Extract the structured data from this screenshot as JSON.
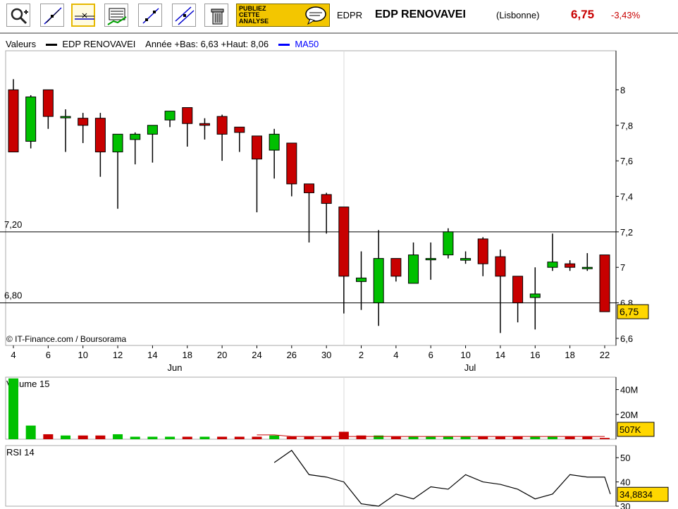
{
  "header": {
    "ticker": "EDPR",
    "name": "EDP RENOVAVEI",
    "market": "(Lisbonne)",
    "price": "6,75",
    "change": "-3,43%"
  },
  "toolbar": {
    "publish_line1": "PUBLIEZ",
    "publish_line2": "CETTE",
    "publish_line3": "ANALYSE",
    "icons": [
      "zoom-icon",
      "trendline-icon",
      "horizontal-line-icon",
      "indicator-icon",
      "fibonacci-icon",
      "parallel-lines-icon",
      "trash-icon",
      "speech-bubble-icon"
    ]
  },
  "legend": {
    "label": "Valeurs",
    "series": "EDP RENOVAVEI",
    "range": "Année +Bas: 6,63 +Haut: 8,06",
    "ma": "MA50"
  },
  "colors": {
    "up": "#00c000",
    "down": "#c80000",
    "ma": "#0000ff",
    "grid": "#d9d9d9",
    "highlight": "#ffd700"
  },
  "chart_data": [
    {
      "type": "candlestick",
      "ylim": [
        6.56,
        8.22
      ],
      "y_ticks": [
        "6,6",
        "6,8",
        "7",
        "7,2",
        "7,4",
        "7,6",
        "7,8",
        "8"
      ],
      "x_tick_labels": [
        "4",
        "6",
        "10",
        "12",
        "14",
        "18",
        "20",
        "24",
        "26",
        "30",
        "2",
        "4",
        "6",
        "10",
        "14",
        "16",
        "18",
        "22"
      ],
      "month_labels": [
        "Jun",
        "Jul"
      ],
      "reference_lines": [
        {
          "value": 7.2,
          "label": "7,20"
        },
        {
          "value": 6.8,
          "label": "6,80"
        }
      ],
      "last_value_label": "6,75",
      "copyright": "© IT-Finance.com / Boursorama",
      "candles": [
        {
          "o": 8.0,
          "h": 8.06,
          "l": 7.65,
          "c": 7.65
        },
        {
          "o": 7.71,
          "h": 7.97,
          "l": 7.67,
          "c": 7.96
        },
        {
          "o": 8.0,
          "h": 8.0,
          "l": 7.78,
          "c": 7.85
        },
        {
          "o": 7.85,
          "h": 7.89,
          "l": 7.65,
          "c": 7.85
        },
        {
          "o": 7.84,
          "h": 7.87,
          "l": 7.7,
          "c": 7.8
        },
        {
          "o": 7.84,
          "h": 7.87,
          "l": 7.51,
          "c": 7.65
        },
        {
          "o": 7.65,
          "h": 7.75,
          "l": 7.33,
          "c": 7.75
        },
        {
          "o": 7.72,
          "h": 7.76,
          "l": 7.58,
          "c": 7.75
        },
        {
          "o": 7.75,
          "h": 7.8,
          "l": 7.59,
          "c": 7.8
        },
        {
          "o": 7.83,
          "h": 7.88,
          "l": 7.79,
          "c": 7.88
        },
        {
          "o": 7.9,
          "h": 7.9,
          "l": 7.68,
          "c": 7.81
        },
        {
          "o": 7.81,
          "h": 7.84,
          "l": 7.72,
          "c": 7.8
        },
        {
          "o": 7.85,
          "h": 7.86,
          "l": 7.6,
          "c": 7.75
        },
        {
          "o": 7.79,
          "h": 7.79,
          "l": 7.65,
          "c": 7.76
        },
        {
          "o": 7.74,
          "h": 7.74,
          "l": 7.31,
          "c": 7.61
        },
        {
          "o": 7.66,
          "h": 7.78,
          "l": 7.5,
          "c": 7.75
        },
        {
          "o": 7.7,
          "h": 7.7,
          "l": 7.4,
          "c": 7.47
        },
        {
          "o": 7.47,
          "h": 7.47,
          "l": 7.14,
          "c": 7.42
        },
        {
          "o": 7.41,
          "h": 7.42,
          "l": 7.19,
          "c": 7.36
        },
        {
          "o": 7.34,
          "h": 7.34,
          "l": 6.74,
          "c": 6.95
        },
        {
          "o": 6.92,
          "h": 7.09,
          "l": 6.76,
          "c": 6.94
        },
        {
          "o": 6.8,
          "h": 7.21,
          "l": 6.67,
          "c": 7.05
        },
        {
          "o": 7.05,
          "h": 7.05,
          "l": 6.92,
          "c": 6.95
        },
        {
          "o": 6.91,
          "h": 7.14,
          "l": 6.91,
          "c": 7.07
        },
        {
          "o": 7.05,
          "h": 7.14,
          "l": 6.93,
          "c": 7.05
        },
        {
          "o": 7.07,
          "h": 7.22,
          "l": 7.05,
          "c": 7.2
        },
        {
          "o": 7.04,
          "h": 7.09,
          "l": 7.02,
          "c": 7.05
        },
        {
          "o": 7.16,
          "h": 7.17,
          "l": 6.95,
          "c": 7.02
        },
        {
          "o": 7.06,
          "h": 7.1,
          "l": 6.63,
          "c": 6.95
        },
        {
          "o": 6.95,
          "h": 6.95,
          "l": 6.69,
          "c": 6.8
        },
        {
          "o": 6.83,
          "h": 7.0,
          "l": 6.65,
          "c": 6.85
        },
        {
          "o": 7.0,
          "h": 7.19,
          "l": 6.98,
          "c": 7.03
        },
        {
          "o": 7.02,
          "h": 7.04,
          "l": 6.98,
          "c": 7.0
        },
        {
          "o": 7.0,
          "h": 7.08,
          "l": 6.98,
          "c": 7.0
        },
        {
          "o": 7.07,
          "h": 7.07,
          "l": 6.75,
          "c": 6.75
        }
      ]
    },
    {
      "type": "bar",
      "title": "Volume 15",
      "ylim": [
        0,
        50
      ],
      "y_ticks": [
        "20M",
        "40M"
      ],
      "last_value_label": "507K",
      "values": [
        49,
        11,
        4,
        3,
        3,
        3,
        4,
        2,
        2,
        2,
        2,
        2,
        2,
        2,
        2,
        3,
        2,
        2,
        2,
        6,
        3,
        3,
        2,
        2,
        2,
        2,
        2,
        2,
        2,
        2,
        2,
        2,
        2,
        2,
        1
      ],
      "up_down": [
        "u",
        "u",
        "d",
        "u",
        "d",
        "d",
        "u",
        "u",
        "u",
        "u",
        "d",
        "u",
        "d",
        "d",
        "d",
        "u",
        "d",
        "d",
        "d",
        "d",
        "d",
        "u",
        "d",
        "u",
        "u",
        "u",
        "u",
        "d",
        "d",
        "d",
        "u",
        "u",
        "d",
        "d",
        "d"
      ]
    },
    {
      "type": "line",
      "title": "RSI 14",
      "ylim": [
        30,
        55
      ],
      "y_ticks": [
        "30",
        "40",
        "50"
      ],
      "last_value_label": "34,8834",
      "values": [
        null,
        null,
        null,
        null,
        null,
        null,
        null,
        null,
        null,
        null,
        null,
        null,
        null,
        null,
        null,
        48,
        53,
        43,
        42,
        40,
        31,
        30,
        35,
        33,
        38,
        37,
        43,
        40,
        39,
        37,
        33,
        35,
        43,
        42,
        42,
        35
      ]
    }
  ]
}
